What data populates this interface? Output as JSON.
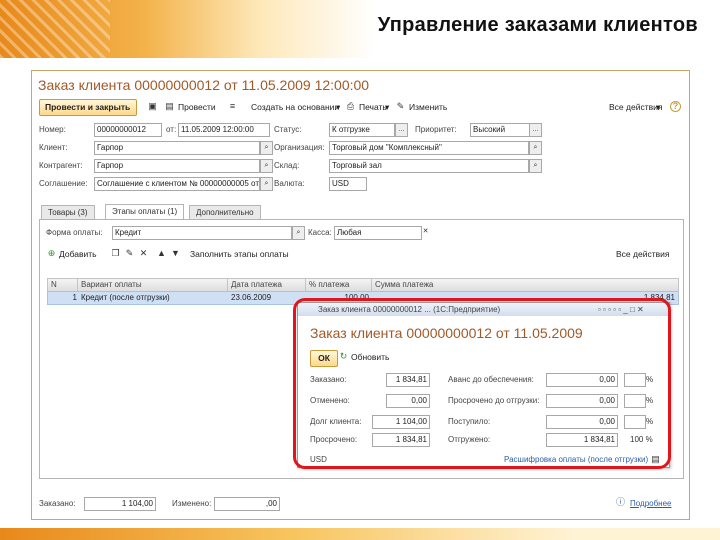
{
  "slide": {
    "title": "Управление заказами клиентов"
  },
  "window": {
    "title": "Заказ клиента 00000000012 от 11.05.2009 12:00:00",
    "toolbar": {
      "post_close": "Провести и закрыть",
      "post": "Провести",
      "create_based": "Создать на основании",
      "print": "Печать",
      "edit": "Изменить",
      "all_actions": "Все действия",
      "help": "?"
    },
    "fields": {
      "number_label": "Номер:",
      "number_value": "00000000012",
      "from_label": "от:",
      "from_value": "11.05.2009 12:00:00",
      "status_label": "Статус:",
      "status_value": "К отгрузке",
      "priority_label": "Приоритет:",
      "priority_value": "Высокий",
      "client_label": "Клиент:",
      "client_value": "Гарпор",
      "org_label": "Организация:",
      "org_value": "Торговый дом \"Комплексный\"",
      "contractor_label": "Контрагент:",
      "contractor_value": "Гарпор",
      "warehouse_label": "Склад:",
      "warehouse_value": "Торговый зал",
      "agreement_label": "Соглашение:",
      "agreement_value": "Соглашение с клиентом № 00000000005 от",
      "currency_label": "Валюта:",
      "currency_value": "USD"
    },
    "tabs": [
      {
        "label": "Товары (3)"
      },
      {
        "label": "Этапы оплаты (1)"
      },
      {
        "label": "Дополнительно"
      }
    ],
    "payment": {
      "form_label": "Форма оплаты:",
      "form_value": "Кредит",
      "cash_label": "Касса:",
      "cash_value": "Любая",
      "add": "Добавить",
      "fill": "Заполнить этапы оплаты",
      "all_actions": "Все действия",
      "columns": [
        "N",
        "Вариант оплаты",
        "Дата платежа",
        "% платежа",
        "Сумма платежа"
      ],
      "rows": [
        {
          "n": "1",
          "variant": "Кредит (после отгрузки)",
          "date": "23.06.2009",
          "percent": "100,00",
          "sum": "1 834,81"
        }
      ]
    },
    "footer": {
      "ordered_label": "Заказано:",
      "ordered_value": "1 104,00",
      "changed_label": "Изменено:",
      "changed_value": ",00",
      "details_link": "Подробнее"
    }
  },
  "popup": {
    "toolbar_title": "Заказ клиента 00000000012 ... (1С:Предприятие)",
    "title": "Заказ клиента 00000000012 от 11.05.2009",
    "ok": "ОК",
    "refresh": "Обновить",
    "rows_left": [
      {
        "label": "Заказано:",
        "value": "1 834,81"
      },
      {
        "label": "Отменено:",
        "value": "0,00"
      },
      {
        "label": "Долг клиента:",
        "value": "1 104,00"
      },
      {
        "label": "Просрочено:",
        "value": "1 834,81"
      }
    ],
    "rows_right": [
      {
        "label": "Аванс до обеспечения:",
        "value": "0,00",
        "pct": "%"
      },
      {
        "label": "Просрочено до отгрузки:",
        "value": "0,00",
        "pct": "%"
      },
      {
        "label": "Поступило:",
        "value": "0,00",
        "pct": "%"
      },
      {
        "label": "Отгружено:",
        "value": "1 834,81",
        "pct": "100 %"
      }
    ],
    "footer_left": "USD",
    "footer_link": "Расшифровка оплаты (после отгрузки)"
  },
  "colors": {
    "accent_orange": "#e8891a",
    "title_brown": "#a05a28",
    "highlight_red": "#e2161a",
    "row_selected": "#cfe0f5"
  }
}
